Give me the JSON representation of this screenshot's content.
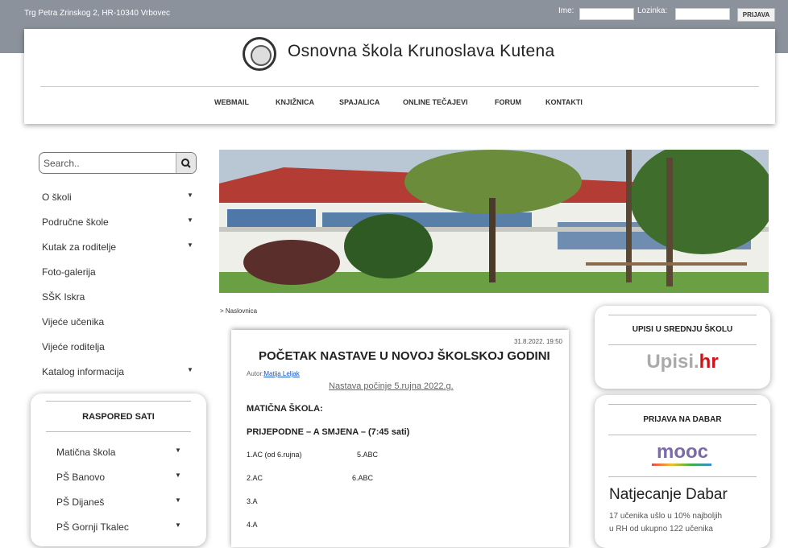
{
  "topbar": {
    "address": "Trg Petra Zrinskog 2, HR-10340 Vrbovec",
    "user_label": "Ime:",
    "pass_label": "Lozinka:",
    "login_button": "PRIJAVA"
  },
  "header": {
    "site_name": "Osnovna škola Krunoslava Kutena",
    "nav": [
      "WEBMAIL",
      "KNJIŽNICA",
      "SPAJALICA",
      "ONLINE TEČAJEVI",
      "FORUM",
      "KONTAKTI"
    ]
  },
  "search": {
    "placeholder": "Search.."
  },
  "sidebar": {
    "items": [
      {
        "label": "O školi"
      },
      {
        "label": "Područne škole"
      },
      {
        "label": "Kutak za roditelje"
      },
      {
        "label": "Foto-galerija"
      },
      {
        "label": "SŠK Iskra"
      },
      {
        "label": "Vijeće učenika"
      },
      {
        "label": "Vijeće roditelja"
      },
      {
        "label": "Katalog informacija"
      }
    ]
  },
  "raspored": {
    "title": "RASPORED SATI",
    "items": [
      "Matična škola",
      "PŠ Banovo",
      "PŠ Dijaneš",
      "PŠ Gornji Tkalec"
    ]
  },
  "breadcrumb": "> Naslovnica",
  "article": {
    "date": "31.8.2022. 19:50",
    "title": "POČETAK NASTAVE U NOVOJ ŠKOLSKOJ GODINI",
    "author_label": "Autor:",
    "author": "Matija Leljak",
    "subtitle": "Nastava počinje 5.rujna 2022.g.",
    "heading1": "MATIČNA ŠKOLA:",
    "heading2": "PRIJEPODNE – A SMJENA – (7:45 sati)",
    "rows": [
      [
        "1.AC (od 6.rujna)",
        "5.ABC"
      ],
      [
        "2.AC",
        "6.ABC"
      ],
      [
        "3.A",
        ""
      ],
      [
        "4.A",
        ""
      ]
    ]
  },
  "right": {
    "upisi_title": "UPISI U SREDNJU ŠKOLU",
    "upisi_logo_a": "Upisi.",
    "upisi_logo_b": "hr",
    "dabar_title": "PRIJAVA NA DABAR",
    "mooc": "mooc",
    "natjecanje": "Natjecanje Dabar",
    "natjecanje_text1": "17 učenika ušlo u 10% najboljih",
    "natjecanje_text2": "u RH od ukupno 122 učenika"
  },
  "colors": {
    "topbar": "#8b929c",
    "link": "#1a56c8",
    "upisi_red": "#d0121b"
  }
}
